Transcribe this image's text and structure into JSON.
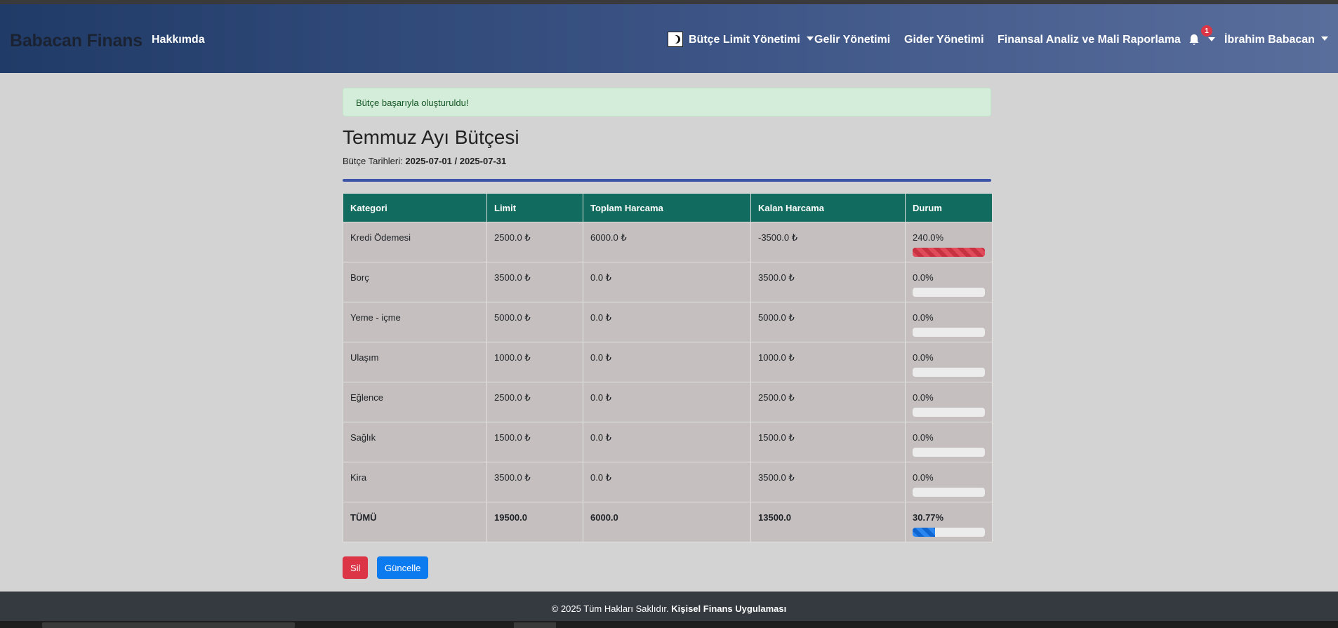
{
  "navbar": {
    "brand": "Babacan Finans",
    "about": "Hakkımda",
    "budget_menu": "Bütçe Limit Yönetimi",
    "income": "Gelir Yönetimi",
    "expense": "Gider Yönetimi",
    "analysis": "Finansal Analiz ve Mali Raporlama",
    "notification_count": "1",
    "user": "İbrahim Babacan"
  },
  "alert": {
    "message": "Bütçe başarıyla oluşturuldu!"
  },
  "budget": {
    "title": "Temmuz Ayı Bütçesi",
    "dates_label": "Bütçe Tarihleri:",
    "dates_value": "2025-07-01 / 2025-07-31"
  },
  "table": {
    "headers": [
      "Kategori",
      "Limit",
      "Toplam Harcama",
      "Kalan Harcama",
      "Durum"
    ],
    "rows": [
      {
        "category": "Kredi Ödemesi",
        "limit": "2500.0 ₺",
        "spent": "6000.0 ₺",
        "remaining": "-3500.0 ₺",
        "status": "240.0%",
        "progress": 100,
        "over": true
      },
      {
        "category": "Borç",
        "limit": "3500.0 ₺",
        "spent": "0.0 ₺",
        "remaining": "3500.0 ₺",
        "status": "0.0%",
        "progress": 0,
        "over": false
      },
      {
        "category": "Yeme - içme",
        "limit": "5000.0 ₺",
        "spent": "0.0 ₺",
        "remaining": "5000.0 ₺",
        "status": "0.0%",
        "progress": 0,
        "over": false
      },
      {
        "category": "Ulaşım",
        "limit": "1000.0 ₺",
        "spent": "0.0 ₺",
        "remaining": "1000.0 ₺",
        "status": "0.0%",
        "progress": 0,
        "over": false
      },
      {
        "category": "Eğlence",
        "limit": "2500.0 ₺",
        "spent": "0.0 ₺",
        "remaining": "2500.0 ₺",
        "status": "0.0%",
        "progress": 0,
        "over": false
      },
      {
        "category": "Sağlık",
        "limit": "1500.0 ₺",
        "spent": "0.0 ₺",
        "remaining": "1500.0 ₺",
        "status": "0.0%",
        "progress": 0,
        "over": false
      },
      {
        "category": "Kira",
        "limit": "3500.0 ₺",
        "spent": "0.0 ₺",
        "remaining": "3500.0 ₺",
        "status": "0.0%",
        "progress": 0,
        "over": false
      }
    ],
    "total": {
      "category": "TÜMÜ",
      "limit": "19500.0",
      "spent": "6000.0",
      "remaining": "13500.0",
      "status": "30.77%",
      "progress": 30.77
    }
  },
  "actions": {
    "delete_label": "Sil",
    "update_label": "Güncelle"
  },
  "footer": {
    "text": "© 2025 Tüm Hakları Saklıdır.",
    "app_name": "Kişisel Finans Uygulaması"
  },
  "colors": {
    "table_header": "#116b5f",
    "danger": "#dc3545",
    "primary": "#0d7bf0",
    "alert_bg": "#d4edda"
  }
}
